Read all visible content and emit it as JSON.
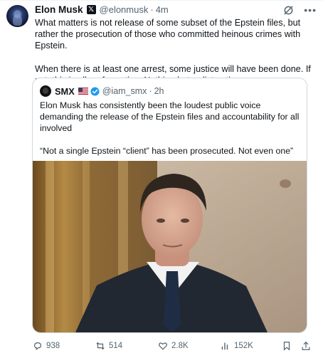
{
  "tweet": {
    "author_name": "Elon Musk",
    "handle": "@elonmusk",
    "separator": "·",
    "time": "4m",
    "text": "What matters is not release of some subset of the Epstein files, but rather the prosecution of those who committed heinous crimes with Epstein.\n\nWhen there is at least one arrest, some justice will have been done. If not, this is all performative. Nothing but a distraction."
  },
  "quote": {
    "author_name": "SMX",
    "handle": "@iam_smx",
    "separator": "·",
    "time": "2h",
    "text": "Elon Musk has consistently been the loudest public voice demanding the release of the Epstein files and accountability for all involved\n\n“Not a single Epstein “client” has been prosecuted. Not even one”\n...",
    "image_icon": "portrait-photo"
  },
  "actions": {
    "replies": "938",
    "reposts": "514",
    "likes": "2.8K",
    "views": "152K"
  },
  "icons": {
    "verified_badge": "x-logo-badge",
    "grok": "grok-icon",
    "more": "more-icon",
    "flag": "us-flag-icon",
    "blue_check": "blue-verified-icon",
    "bookmark": "bookmark-icon",
    "share": "share-icon"
  },
  "colors": {
    "text": "#0f1419",
    "secondary": "#536471",
    "border": "#cfd9de",
    "verified_blue": "#1d9bf0"
  }
}
